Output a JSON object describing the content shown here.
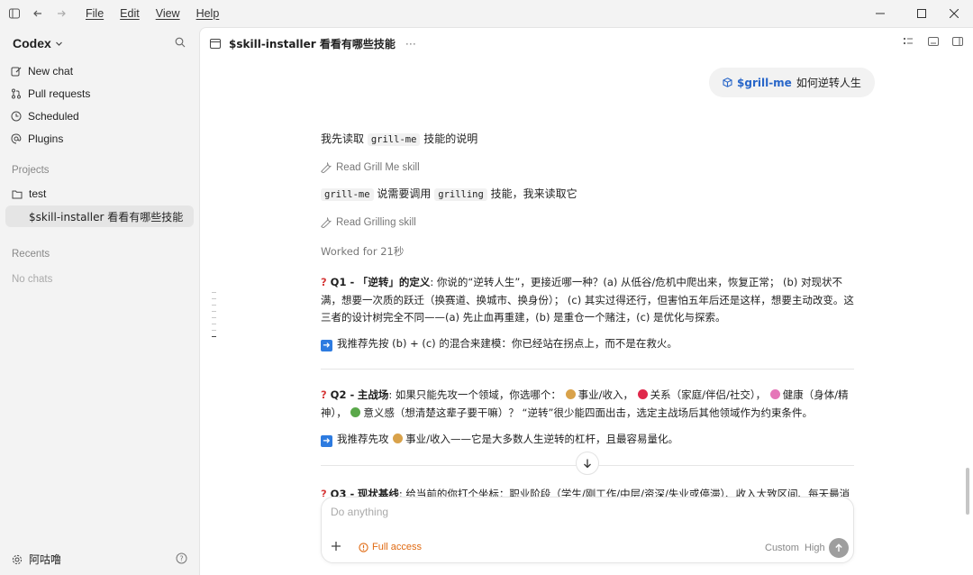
{
  "menu": {
    "file": "File",
    "edit": "Edit",
    "view": "View",
    "help": "Help"
  },
  "sidebar": {
    "app_name": "Codex",
    "nav": [
      {
        "label": "New chat",
        "icon": "edit-icon"
      },
      {
        "label": "Pull requests",
        "icon": "pull-request-icon"
      },
      {
        "label": "Scheduled",
        "icon": "clock-icon"
      },
      {
        "label": "Plugins",
        "icon": "plugin-icon"
      }
    ],
    "projects_label": "Projects",
    "projects": [
      {
        "label": "test",
        "icon": "folder-icon"
      },
      {
        "label": "$skill-installer 看看有哪些技能",
        "active": true
      }
    ],
    "recents_label": "Recents",
    "recents_empty": "No chats",
    "user_name": "阿咕噜"
  },
  "thread": {
    "title": "$skill-installer 看看有哪些技能",
    "more": "···"
  },
  "conversation": {
    "user_skill": "$grill-me",
    "user_text": "如何逆转人生",
    "msg1": {
      "pre": "我先读取",
      "code": "grill-me",
      "post": "技能的说明"
    },
    "tool1": "Read Grill Me skill",
    "msg2": {
      "code1": "grill-me",
      "mid": "说需要调用",
      "code2": "grilling",
      "post": "技能，我来读取它"
    },
    "tool2": "Read Grilling skill",
    "worked": "Worked for 21秒",
    "q1": {
      "label": "Q1 -",
      "title": "「逆转」的定义",
      "body": ": 你说的“逆转人生”，更接近哪一种？(a) 从低谷/危机中爬出来，恢复正常； (b) 对现状不满，想要一次质的跃迁（换赛道、换城市、换身份）； (c) 其实过得还行，但害怕五年后还是这样，想要主动改变。这三者的设计树完全不同——(a) 先止血再重建，(b) 是重仓一个赌注，(c) 是优化与探索。",
      "rec": "我推荐先按 (b) + (c) 的混合来建模：你已经站在拐点上，而不是在救火。"
    },
    "q2": {
      "label": "Q2 -",
      "title": "主战场",
      "body_a": ": 如果只能先攻一个领域，你选哪个：",
      "opt1": "事业/收入，",
      "opt2": "关系（家庭/伴侣/社交），",
      "opt3": "健康（身体/精神），",
      "opt4": "意义感（想清楚这辈子要干嘛）？ “逆转”很少能四面出击，选定主战场后其他领域作为约束条件。",
      "rec_pre": "我推荐先攻",
      "rec_post": "事业/收入——它是大多数人生逆转的杠杆，且最容易量化。"
    },
    "q3_partial": {
      "label": "Q3 -",
      "title": "现状基线",
      "body": ": 给当前的你打个坐标：职业阶段（学生/刚工作/中层/资深/失业或停滞）、收入大致区间、每天最消耗"
    }
  },
  "composer": {
    "placeholder": "Do anything",
    "access": "Full access",
    "model": "Custom",
    "effort": "High"
  },
  "colors": {
    "accent": "#2866c9",
    "warning": "#e06a12"
  }
}
